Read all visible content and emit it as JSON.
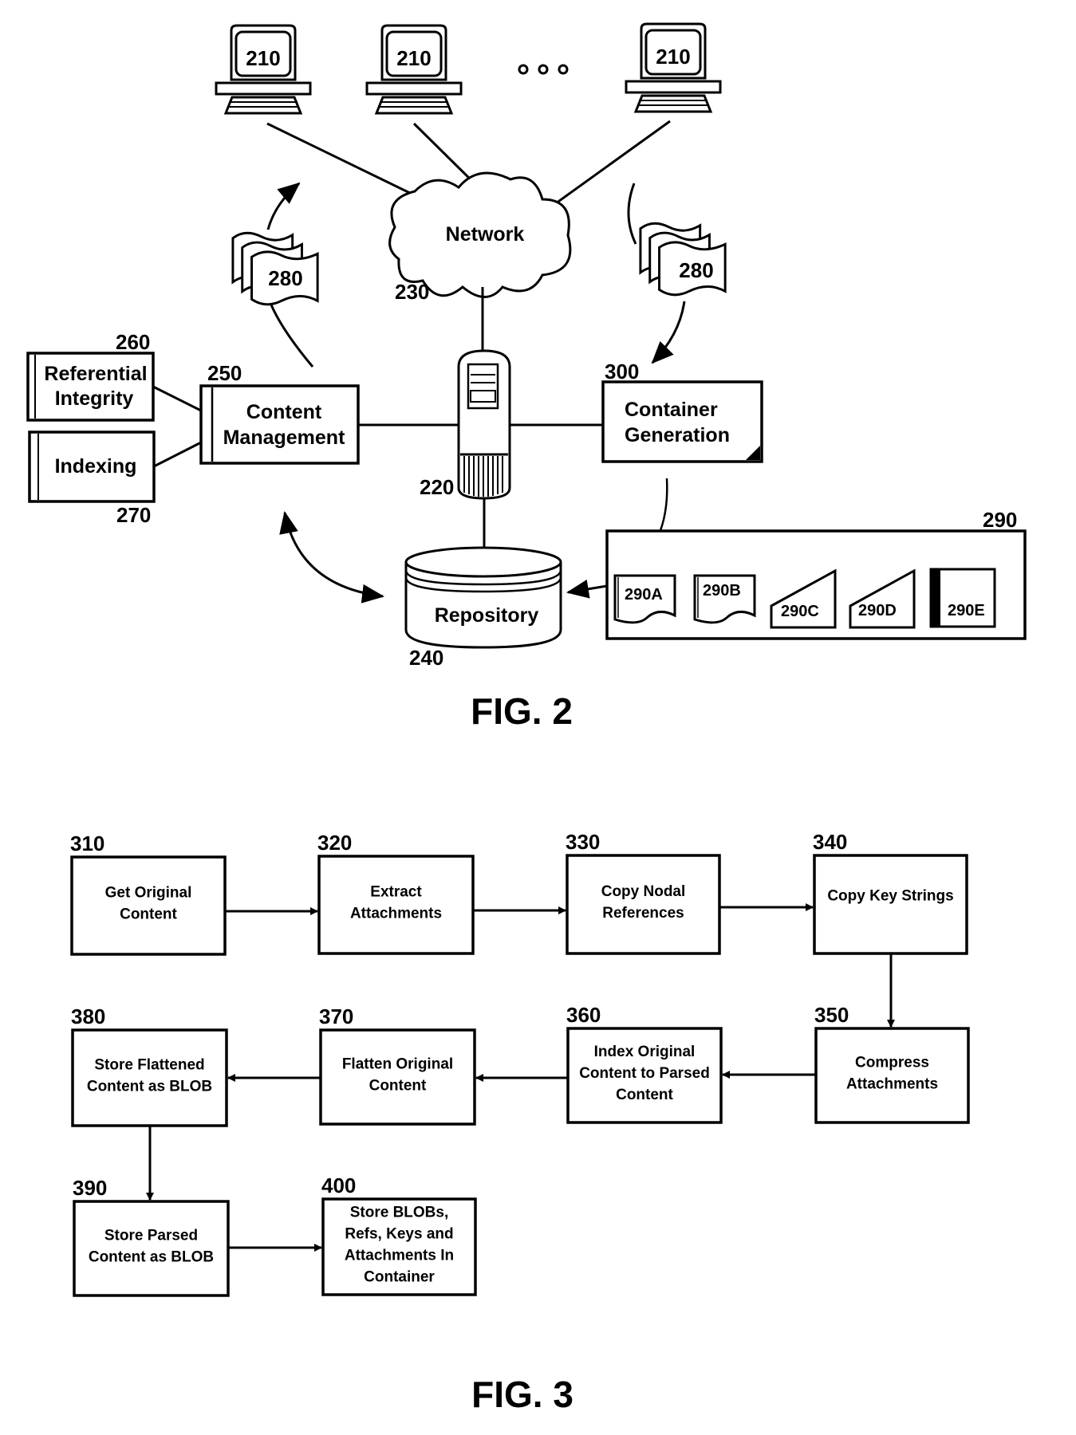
{
  "fig2": {
    "caption": "FIG. 2",
    "clients": [
      {
        "ref": "210"
      },
      {
        "ref": "210"
      },
      {
        "ref": "210"
      }
    ],
    "ellipsis": "ooo",
    "network": {
      "label": "Network",
      "ref": "230"
    },
    "server": {
      "ref": "220"
    },
    "repository": {
      "label": "Repository",
      "ref": "240"
    },
    "content_management": {
      "line1": "Content",
      "line2": "Management",
      "ref": "250"
    },
    "referential_integrity": {
      "line1": "Referential",
      "line2": "Integrity",
      "ref": "260"
    },
    "indexing": {
      "label": "Indexing",
      "ref": "270"
    },
    "documents_left": {
      "ref": "280"
    },
    "documents_right": {
      "ref": "280"
    },
    "container_generation": {
      "line1": "Container",
      "line2": "Generation",
      "ref": "300"
    },
    "containers": {
      "ref": "290",
      "items": [
        {
          "label": "290A",
          "shape": "document"
        },
        {
          "label": "290B",
          "shape": "document"
        },
        {
          "label": "290C",
          "shape": "slanted"
        },
        {
          "label": "290D",
          "shape": "slanted"
        },
        {
          "label": "290E",
          "shape": "bar-left"
        }
      ]
    }
  },
  "fig3": {
    "caption": "FIG. 3",
    "steps": [
      {
        "ref": "310",
        "lines": [
          "Get Original",
          "Content"
        ]
      },
      {
        "ref": "320",
        "lines": [
          "Extract",
          "Attachments"
        ]
      },
      {
        "ref": "330",
        "lines": [
          "Copy Nodal",
          "References"
        ]
      },
      {
        "ref": "340",
        "lines": [
          "Copy Key Strings"
        ]
      },
      {
        "ref": "350",
        "lines": [
          "Compress",
          "Attachments"
        ]
      },
      {
        "ref": "360",
        "lines": [
          "Index Original",
          "Content to Parsed",
          "Content"
        ]
      },
      {
        "ref": "370",
        "lines": [
          "Flatten Original",
          "Content"
        ]
      },
      {
        "ref": "380",
        "lines": [
          "Store Flattened",
          "Content as BLOB"
        ]
      },
      {
        "ref": "390",
        "lines": [
          "Store Parsed",
          "Content as BLOB"
        ]
      },
      {
        "ref": "400",
        "lines": [
          "Store BLOBs,",
          "Refs, Keys and",
          "Attachments In",
          "Container"
        ]
      }
    ]
  }
}
